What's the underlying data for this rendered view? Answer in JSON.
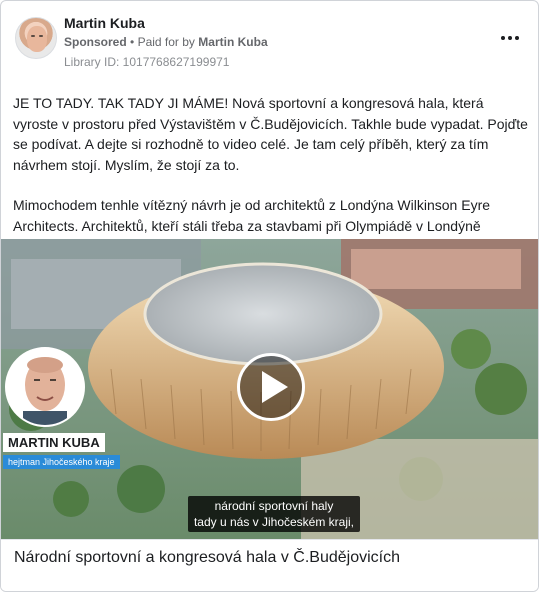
{
  "ad": {
    "page_name": "Martin Kuba",
    "sponsored_label": "Sponsored",
    "paid_for_prefix": "Paid for by",
    "paid_for_name": "Martin Kuba",
    "library_id": "Library ID: 1017768627199971",
    "more_icon": "more-horizontal-icon"
  },
  "body": {
    "paragraph_1": "JE TO TADY. TAK TADY JI MÁME! Nová sportovní a kongresová hala, která vyroste v prostoru před Výstavištěm v Č.Budějovicích. Takhle bude vypadat. Pojďte se podívat. A dejte si rozhodně to video celé. Je tam celý příběh, který za tím návrhem stojí. Myslím, že stojí za to.",
    "paragraph_2": "Mimochodem tenhle vítězný návrh je od architektů z Londýna Wilkinson Eyre Architects. Architektů, kteří stáli třeba za stavbami při Olympiádě v Londýně nebo…"
  },
  "video": {
    "overlay_name": "MARTIN KUBA",
    "overlay_title": "hejtman Jihočeského kraje",
    "subtitle": "národní sportovní haly\ntady u nás v Jihočeském kraji,",
    "play_icon": "play-icon"
  },
  "footer": {
    "title": "Národní sportovní a kongresová hala v Č.Budějovicích"
  }
}
